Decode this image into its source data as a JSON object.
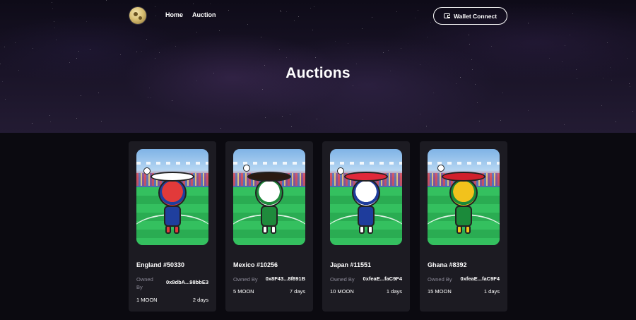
{
  "nav": {
    "links": [
      {
        "label": "Home"
      },
      {
        "label": "Auction"
      }
    ],
    "wallet_button": "Wallet Connect"
  },
  "page_title": "Auctions",
  "cards": [
    {
      "name": "England #50330",
      "owned_label": "Owned By",
      "owner": "0x8dbA...98bbE3",
      "price": "1 MOON",
      "time_left": "2 days",
      "theme": {
        "head": "#e23a3a",
        "accent": "#1f3f9e",
        "hat": "#ffffff"
      }
    },
    {
      "name": "Mexico #10256",
      "owned_label": "Owned By",
      "owner": "0x8F43...8f891B",
      "price": "5 MOON",
      "time_left": "7 days",
      "theme": {
        "head": "#ffffff",
        "accent": "#1f8a3c",
        "hat": "#2a1a12"
      }
    },
    {
      "name": "Japan #11551",
      "owned_label": "Owned By",
      "owner": "0xfeaE...faC9F4",
      "price": "10 MOON",
      "time_left": "1 days",
      "theme": {
        "head": "#ffffff",
        "accent": "#1e3c9c",
        "hat": "#e0283a"
      }
    },
    {
      "name": "Ghana #8392",
      "owned_label": "Owned By",
      "owner": "0xfeaE...faC9F4",
      "price": "15 MOON",
      "time_left": "1 days",
      "theme": {
        "head": "#f2c21c",
        "accent": "#1b8a3a",
        "hat": "#d0202c"
      }
    }
  ]
}
